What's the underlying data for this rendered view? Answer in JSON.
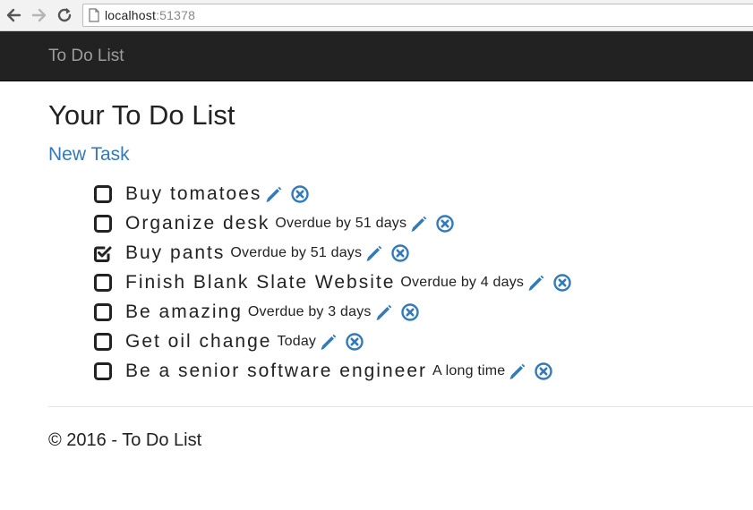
{
  "browser": {
    "url_host": "localhost",
    "url_port": ":51378"
  },
  "navbar": {
    "brand": "To Do List"
  },
  "page": {
    "title": "Your To Do List",
    "new_task_link": "New Task"
  },
  "tasks": [
    {
      "name": "Buy tomatoes",
      "due": "",
      "checked": false
    },
    {
      "name": "Organize desk",
      "due": "Overdue by 51 days",
      "checked": false
    },
    {
      "name": "Buy pants",
      "due": "Overdue by 51 days",
      "checked": true
    },
    {
      "name": "Finish Blank Slate Website",
      "due": "Overdue by 4 days",
      "checked": false
    },
    {
      "name": "Be amazing",
      "due": "Overdue by 3 days",
      "checked": false
    },
    {
      "name": "Get oil change",
      "due": "Today",
      "checked": false
    },
    {
      "name": "Be a senior software engineer",
      "due": "A long time",
      "checked": false
    }
  ],
  "footer": {
    "text": "© 2016 - To Do List"
  },
  "colors": {
    "accent": "#337ab7",
    "navbar_bg": "#222222",
    "brand": "#9d9d9d"
  }
}
